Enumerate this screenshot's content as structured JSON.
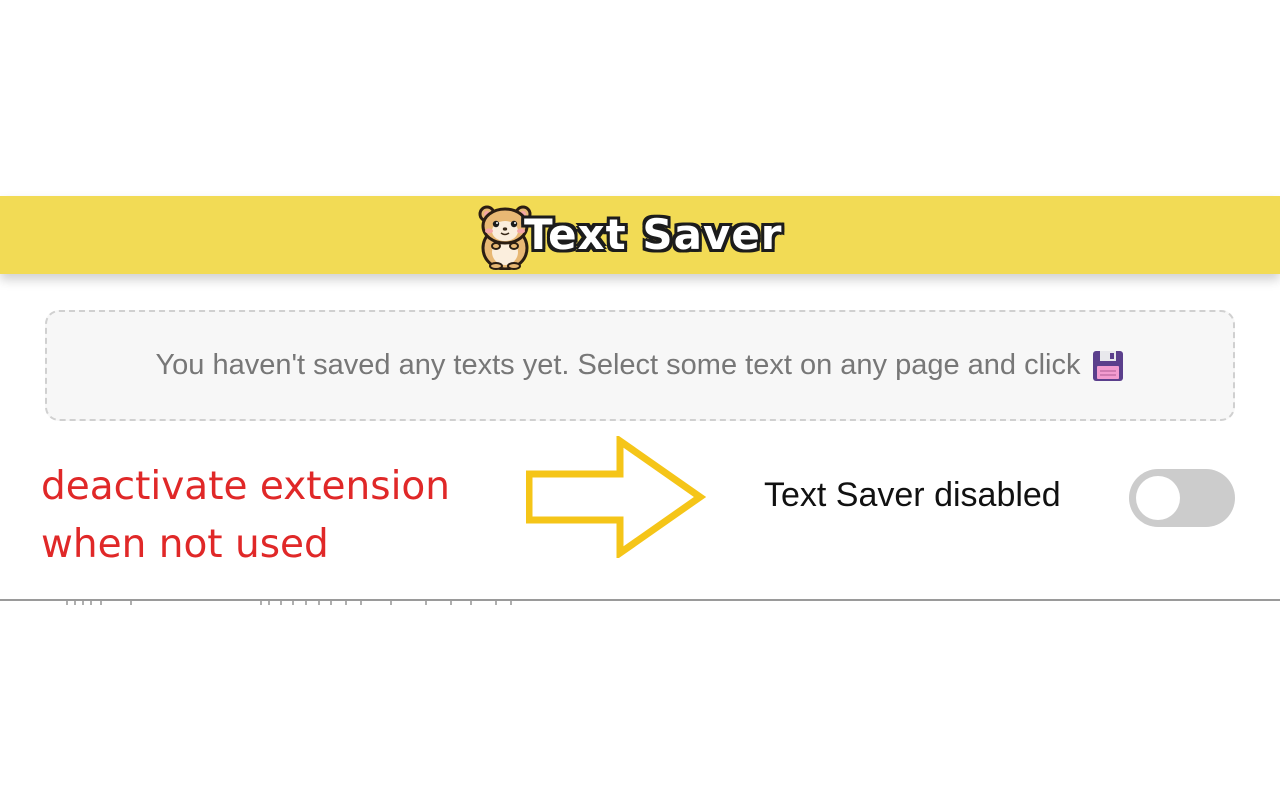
{
  "header": {
    "logo_text": "Text Saver",
    "background_color": "#f2db55"
  },
  "empty_state": {
    "message": "You haven't saved any texts yet. Select some text on any page and click",
    "icon": "floppy-disk-icon"
  },
  "annotation": {
    "line1": "deactivate extension",
    "line2": "when not used",
    "color": "#e02828"
  },
  "arrow": {
    "icon": "right-arrow-icon",
    "color": "#f5c518"
  },
  "status": {
    "label": "Text Saver disabled",
    "toggle_on": false
  }
}
